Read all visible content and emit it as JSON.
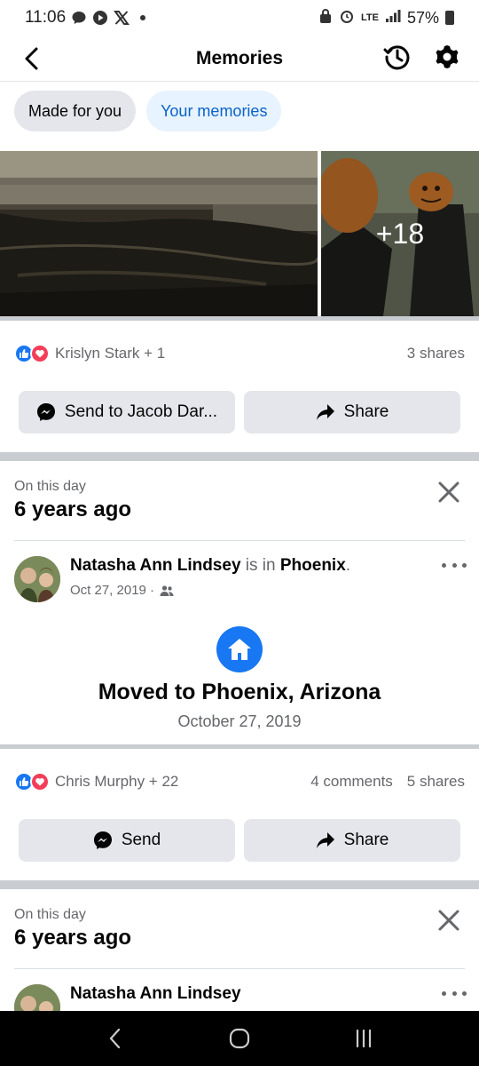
{
  "status_bar": {
    "time": "11:06",
    "network": "LTE",
    "battery": "57%"
  },
  "header": {
    "title": "Memories"
  },
  "chips": {
    "made_for_you": "Made for you",
    "your_memories": "Your memories"
  },
  "photos": {
    "more_count": "+18"
  },
  "post1": {
    "reactors": "Krislyn Stark + 1",
    "shares": "3 shares",
    "send_label": "Send to Jacob Dar...",
    "share_label": "Share"
  },
  "memory1": {
    "on_this_day": "On this day",
    "years_ago": "6 years ago",
    "author": "Natasha Ann Lindsey",
    "is_in": "is in",
    "place": "Phoenix",
    "date": "Oct 27, 2019 ·",
    "life_event_title": "Moved to Phoenix, Arizona",
    "life_event_date": "October 27, 2019",
    "reactors": "Chris Murphy + 22",
    "comments": "4 comments",
    "shares": "5 shares",
    "send_label": "Send",
    "share_label": "Share"
  },
  "memory2": {
    "on_this_day": "On this day",
    "years_ago": "6 years ago",
    "author": "Natasha Ann Lindsey"
  },
  "colors": {
    "accent": "#1877f2",
    "love": "#f33e58",
    "chip_blue_text": "#0a62c8",
    "chip_blue_bg": "#e7f3ff"
  }
}
